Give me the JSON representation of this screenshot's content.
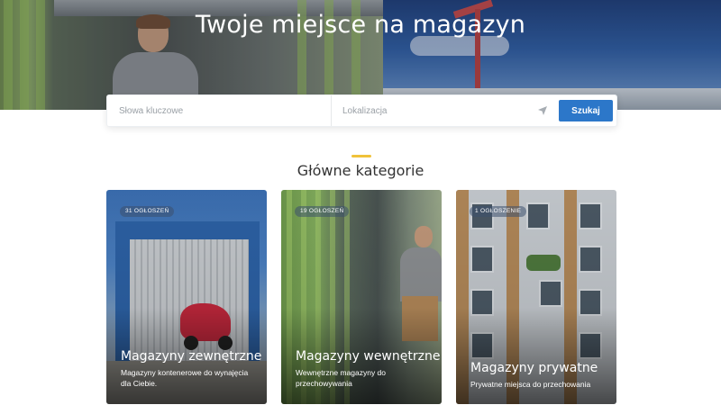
{
  "hero": {
    "title": "Twoje miejsce na magazyn"
  },
  "search": {
    "keywords_placeholder": "Słowa kluczowe",
    "location_placeholder": "Lokalizacja",
    "button_label": "Szukaj",
    "locate_icon": "location-arrow-icon"
  },
  "categories": {
    "title": "Główne kategorie",
    "accent_color": "#f0c23a",
    "items": [
      {
        "badge": "31 OGŁOSZEŃ",
        "title": "Magazyny zewnętrzne",
        "description": "Magazyny kontenerowe do wynajęcia dla Ciebie."
      },
      {
        "badge": "19 OGŁOSZEŃ",
        "title": "Magazyny wewnętrzne",
        "description": "Wewnętrzne magazyny do przechowywania"
      },
      {
        "badge": "1 OGŁOSZENIE",
        "title": "Magazyny prywatne",
        "description": "Prywatne miejsca do przechowania"
      }
    ]
  },
  "colors": {
    "primary_button": "#2c77c9",
    "accent": "#f0c23a"
  }
}
